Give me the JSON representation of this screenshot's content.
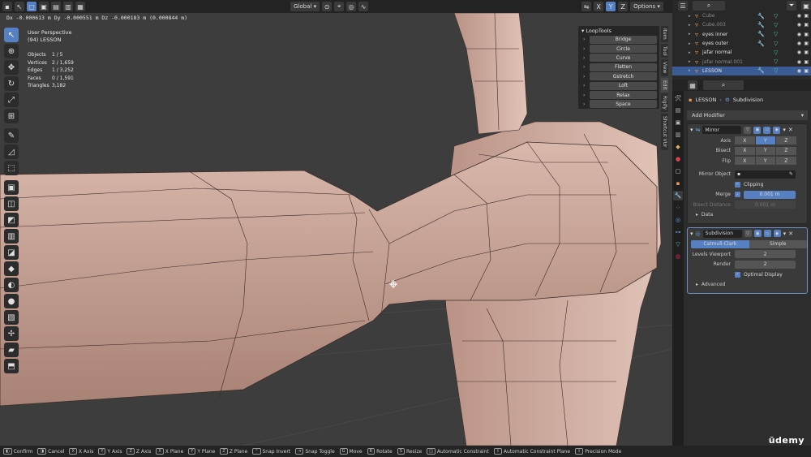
{
  "header": {
    "transform_orientation": "Global",
    "options_label": "Options",
    "axis_labels": [
      "X",
      "Y",
      "Z"
    ],
    "status_line": "Dx -0.000613 m  Dy -0.000551 m  Dz -0.000183 m (0.000844 m)"
  },
  "viewport": {
    "view_name": "User Perspective",
    "object_name": "(94) LESSON",
    "stats": [
      {
        "label": "Objects",
        "value": "1 / 5"
      },
      {
        "label": "Vertices",
        "value": "2 / 1,659"
      },
      {
        "label": "Edges",
        "value": "1 / 3,252"
      },
      {
        "label": "Faces",
        "value": "0 / 1,591"
      },
      {
        "label": "Triangles",
        "value": "3,182"
      }
    ]
  },
  "looptools": {
    "title": "LoopTools",
    "items": [
      "Bridge",
      "Circle",
      "Curve",
      "Flatten",
      "Gstretch",
      "Loft",
      "Relax",
      "Space"
    ]
  },
  "side_tabs": [
    "Item",
    "Tool",
    "View",
    "Edit",
    "Rigify",
    "Shortcut VUr"
  ],
  "outliner": {
    "rows": [
      {
        "name": "Cube",
        "dim": true
      },
      {
        "name": "Cube.003",
        "dim": true
      },
      {
        "name": "eyes inner",
        "dim": false
      },
      {
        "name": "eyes outer",
        "dim": false
      },
      {
        "name": "jafar normal",
        "dim": false
      },
      {
        "name": "jafar normal.001",
        "dim": true
      },
      {
        "name": "LESSON",
        "dim": false,
        "selected": true
      }
    ]
  },
  "properties": {
    "object": "LESSON",
    "section": "Subdivision",
    "add_modifier": "Add Modifier",
    "mirror": {
      "name": "Mirror",
      "axis_label": "Axis",
      "bisect_label": "Bisect",
      "flip_label": "Flip",
      "mirror_object_label": "Mirror Object",
      "clipping_label": "Clipping",
      "merge_label": "Merge",
      "merge_value": "0.001 m",
      "bisect_distance_label": "Bisect Distance",
      "bisect_distance_value": "0.001 m",
      "data_label": "Data"
    },
    "subdivision": {
      "name": "Subdivision",
      "catmull": "Catmull-Clark",
      "simple": "Simple",
      "levels_viewport_label": "Levels Viewport",
      "levels_viewport_value": "2",
      "render_label": "Render",
      "render_value": "2",
      "optimal_display_label": "Optimal Display",
      "advanced_label": "Advanced"
    }
  },
  "statusbar": {
    "hints": [
      {
        "key": "",
        "label": "Confirm"
      },
      {
        "key": "",
        "label": "Cancel"
      },
      {
        "key": "X",
        "label": "X Axis"
      },
      {
        "key": "Y",
        "label": "Y Axis"
      },
      {
        "key": "Z",
        "label": "Z Axis"
      },
      {
        "key": "X",
        "label": "X Plane"
      },
      {
        "key": "Y",
        "label": "Y Plane"
      },
      {
        "key": "Z",
        "label": "Z Plane"
      },
      {
        "key": "",
        "label": "Snap Invert"
      },
      {
        "key": "",
        "label": "Snap Toggle"
      },
      {
        "key": "G",
        "label": "Move"
      },
      {
        "key": "R",
        "label": "Rotate"
      },
      {
        "key": "S",
        "label": "Resize"
      },
      {
        "key": "",
        "label": "Automatic Constraint"
      },
      {
        "key": "",
        "label": "Automatic Constraint Plane"
      },
      {
        "key": "",
        "label": "Precision Mode"
      }
    ]
  },
  "watermark": "ūdemy",
  "colors": {
    "accent": "#5680c2",
    "mesh": "#c8a598",
    "background": "#3d3d3d"
  }
}
